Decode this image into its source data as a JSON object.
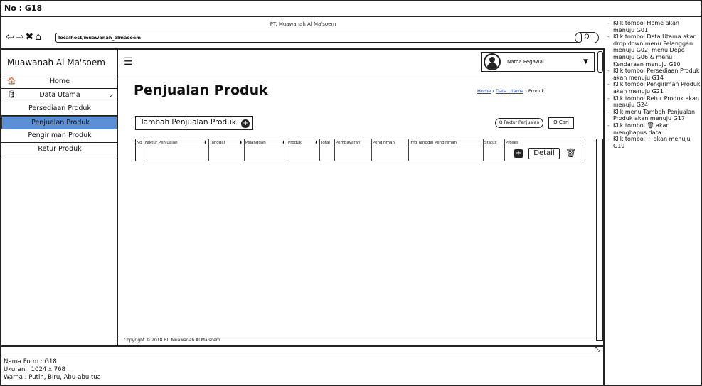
{
  "header": {
    "label": "No : G18"
  },
  "browser": {
    "window_title": "PT. Muawanah Al Ma'soem",
    "address": "localhost/muawanah_almasoem",
    "search_icon": "Q"
  },
  "sidebar": {
    "brand": "Muawanah Al Ma'soem",
    "items": [
      {
        "label": "Home",
        "icon": "home-icon"
      },
      {
        "label": "Data Utama",
        "icon": "database-icon"
      },
      {
        "label": "Persediaan Produk"
      },
      {
        "label": "Penjualan Produk",
        "active": true
      },
      {
        "label": "Pengiriman Produk"
      },
      {
        "label": "Retur Produk"
      }
    ]
  },
  "appbar": {
    "user_name": "Nama Pegawai"
  },
  "page": {
    "title": "Penjualan Produk",
    "breadcrumb": {
      "home": "Home",
      "data_utama": "Data Utama",
      "current": "Produk"
    },
    "add_button": "Tambah Penjualan Produk",
    "search_placeholder": "Q Faktur Penjualan",
    "search_button": "Q Cari",
    "detail_button": "Detail",
    "footer": "Copyright © 2018 PT. Muawanah Al Ma'soem"
  },
  "table": {
    "columns": [
      "No",
      "Faktur Penjualan",
      "Tanggal",
      "Pelanggan",
      "Produk",
      "Total",
      "Pembayaran",
      "Pengiriman",
      "Info Tanggal Pengiriman",
      "Status",
      "Proses"
    ]
  },
  "info": {
    "lines": [
      "Nama Form : G18",
      "Ukuran : 1024 x 768",
      "Warna : Putih, Biru, Abu-abu tua"
    ]
  },
  "notes": [
    "Klik tombol Home akan menuju G01",
    "Klik tombol Data Utama akan drop down menu Pelanggan menuju G02, menu Depo menuju G06 & menu Kendaraan menuju G10",
    "Klik tombol Persediaan Produk akan menuju G14",
    "Klik tombol Pengiriman Produk akan menuju G21",
    "Klik tombol Retur Produk akan menuju G24",
    "Klik menu Tambah Penjualan Produk akan menuju G17",
    "Klik tombol 🗑 akan menghapus data",
    "Klik tombol + akan menuju G19"
  ],
  "colors": {
    "active_item": "#5b8fd6",
    "link": "#1a49c9"
  }
}
